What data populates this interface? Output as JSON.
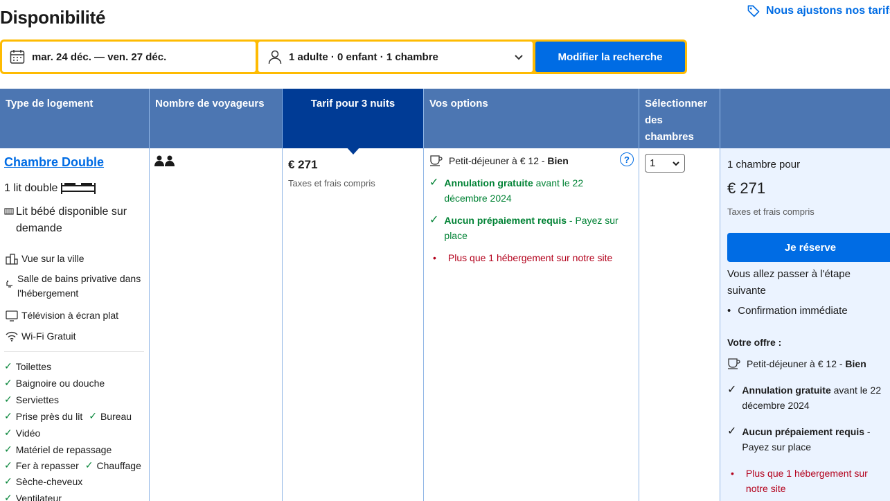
{
  "page": {
    "title": "Disponibilité",
    "adjust_link": "Nous ajustons nos tarifs"
  },
  "search": {
    "dates": "mar. 24 déc. — ven. 27 déc.",
    "guests": "1 adulte · 0 enfant · 1 chambre",
    "button": "Modifier la recherche"
  },
  "table": {
    "headers": {
      "type": "Type de logement",
      "guests": "Nombre de voyageurs",
      "price": "Tarif pour 3 nuits",
      "options": "Vos options",
      "select": "Sélectionner des chambres"
    }
  },
  "room": {
    "name": "Chambre Double",
    "bed": "1 lit double",
    "crib": "Lit bébé disponible sur demande",
    "facilities": [
      {
        "icon": "city-view-icon",
        "label": "Vue sur la ville"
      },
      {
        "icon": "bath-icon",
        "label": "Salle de bains privative dans l'hébergement"
      },
      {
        "icon": "tv-icon",
        "label": "Télévision à écran plat"
      },
      {
        "icon": "wifi-icon",
        "label": "Wi-Fi Gratuit"
      }
    ],
    "amenities": [
      [
        "Toilettes"
      ],
      [
        "Baignoire ou douche"
      ],
      [
        "Serviettes"
      ],
      [
        "Prise près du lit",
        "Bureau"
      ],
      [
        "Vidéo"
      ],
      [
        "Matériel de repassage"
      ],
      [
        "Fer à repasser",
        "Chauffage"
      ],
      [
        "Sèche-cheveux"
      ],
      [
        "Ventilateur"
      ]
    ]
  },
  "price": {
    "amount": "€ 271",
    "note": "Taxes et frais compris"
  },
  "options": {
    "breakfast_prefix": "Petit-déjeuner à € 12 - ",
    "breakfast_rating": "Bien",
    "cancel_bold": "Annulation gratuite",
    "cancel_rest": " avant le 22 décembre 2024",
    "prepay_bold": "Aucun prépaiement requis",
    "prepay_rest": " - Payez sur place",
    "scarcity": "Plus que 1 hébergement sur notre site"
  },
  "select": {
    "value": "1"
  },
  "reserve": {
    "for_label": "1 chambre pour",
    "total": "€ 271",
    "note": "Taxes et frais compris",
    "button": "Je réserve",
    "next_step": "Vous allez passer à l'étape suivante",
    "bullet": "Confirmation immédiate",
    "offer_title": "Votre offre :",
    "breakfast_prefix": "Petit-déjeuner à € 12 - ",
    "breakfast_rating": "Bien",
    "cancel_bold": "Annulation gratuite",
    "cancel_rest": " avant le 22 décembre 2024",
    "prepay_bold": "Aucun prépaiement requis",
    "prepay_rest": " - Payez sur place",
    "scarcity": "Plus que 1 hébergement sur notre site"
  }
}
